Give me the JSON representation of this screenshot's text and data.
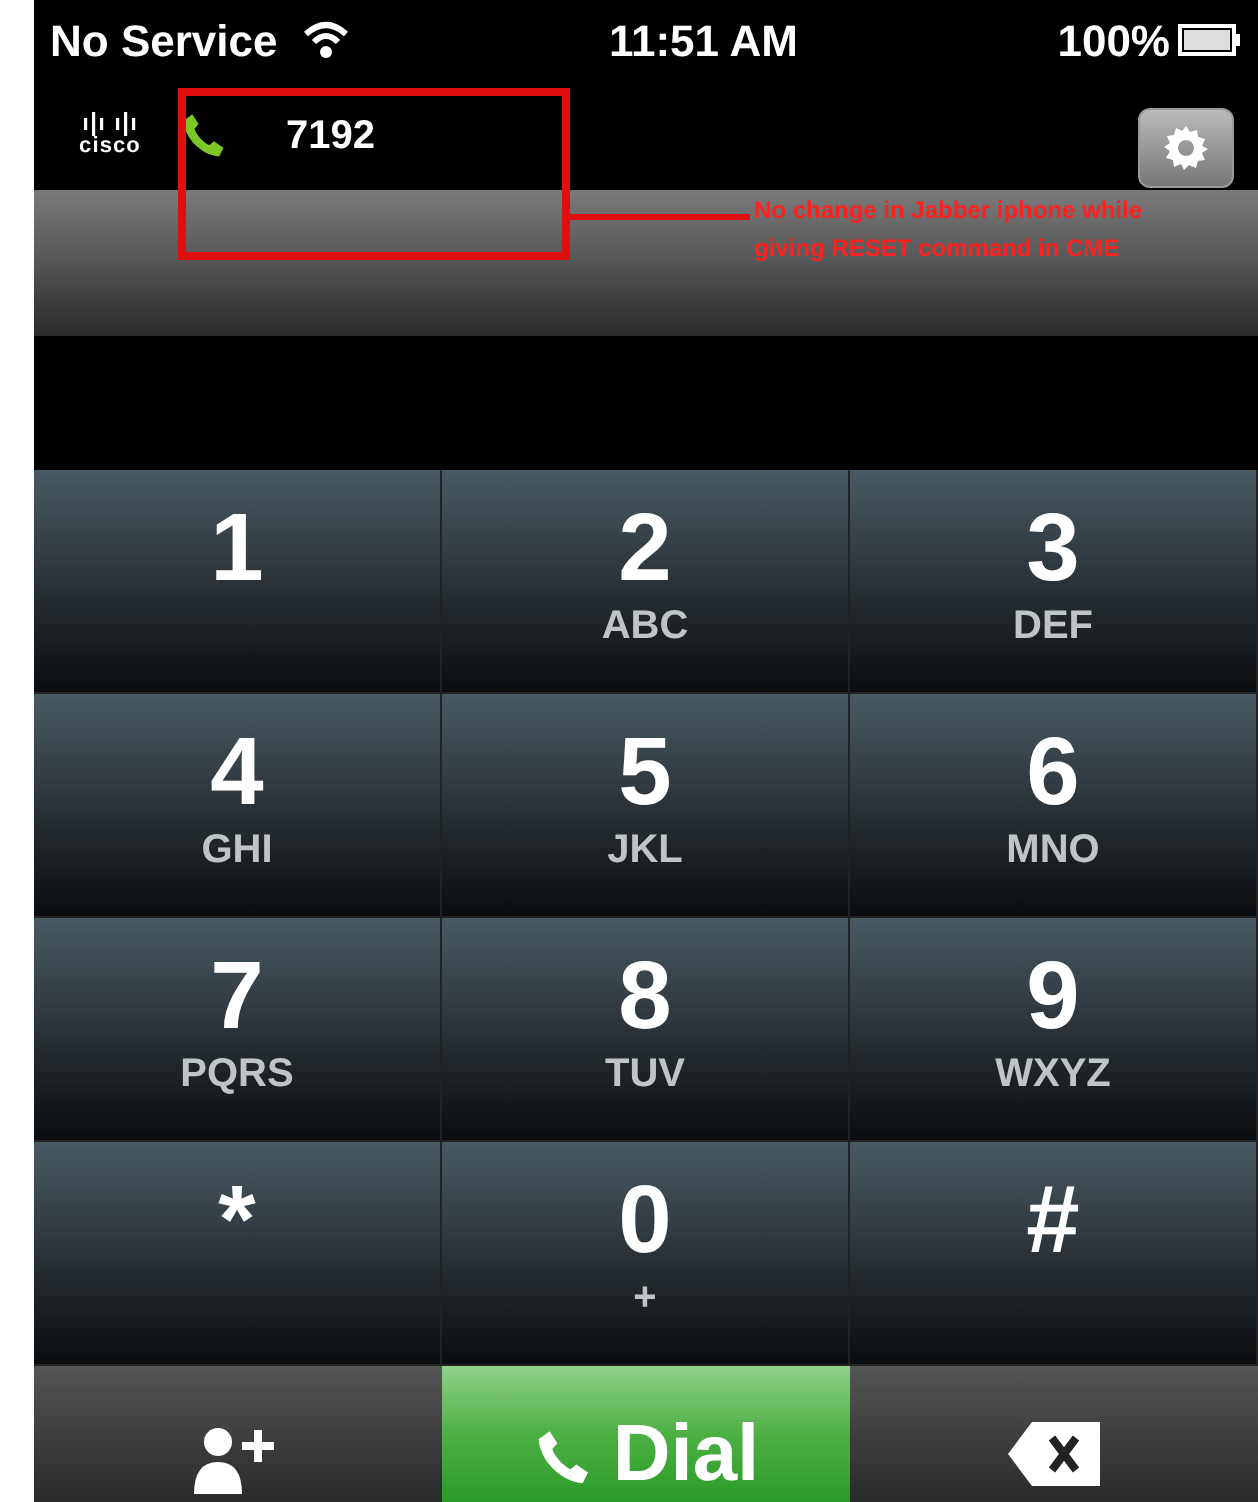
{
  "status_bar": {
    "carrier": "No Service",
    "time": "11:51 AM",
    "battery": "100%"
  },
  "header": {
    "logo": "cisco",
    "line": "7192"
  },
  "annotation": {
    "text": "No change in Jabber iphone while giving RESET command in CME"
  },
  "keypad": [
    {
      "digit": "1"
    },
    {
      "digit": "2",
      "letters": "ABC"
    },
    {
      "digit": "3",
      "letters": "DEF"
    },
    {
      "digit": "4",
      "letters": "GHI"
    },
    {
      "digit": "5",
      "letters": "JKL"
    },
    {
      "digit": "6",
      "letters": "MNO"
    },
    {
      "digit": "7",
      "letters": "PQRS"
    },
    {
      "digit": "8",
      "letters": "TUV"
    },
    {
      "digit": "9",
      "letters": "WXYZ"
    },
    {
      "digit": "*"
    },
    {
      "digit": "0",
      "letters": "+"
    },
    {
      "digit": "#"
    }
  ],
  "actions": {
    "dial": "Dial"
  }
}
